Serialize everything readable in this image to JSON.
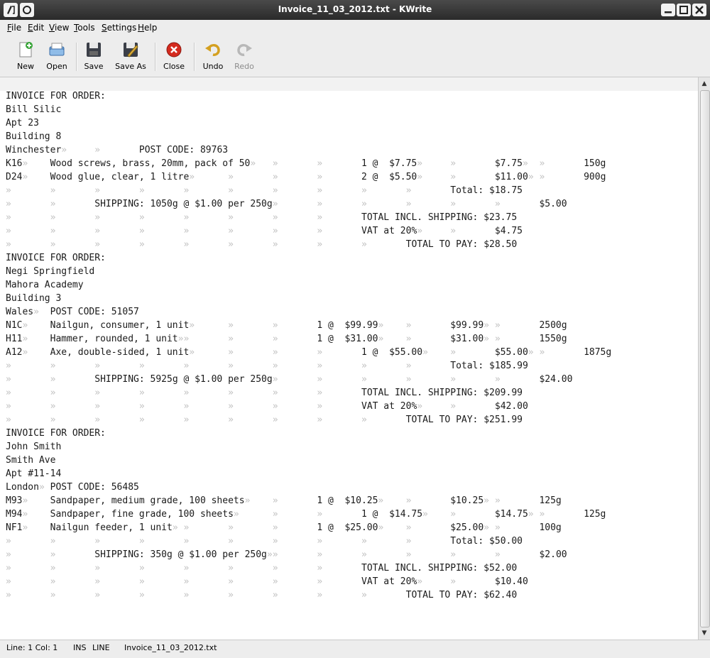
{
  "window": {
    "title": "Invoice_11_03_2012.txt - KWrite"
  },
  "menu": [
    "File",
    "Edit",
    "View",
    "Tools",
    "Settings",
    "Help"
  ],
  "toolbar": {
    "new": "New",
    "open": "Open",
    "save": "Save",
    "save_as": "Save As",
    "close": "Close",
    "undo": "Undo",
    "redo": "Redo"
  },
  "editor": {
    "tab_marker": "»",
    "lines": [
      [
        "INVOICE FOR ORDER:"
      ],
      [
        "Bill Silic"
      ],
      [
        "Apt 23"
      ],
      [
        "Building 8"
      ],
      [
        "Winchester",
        "",
        "POST CODE: 89763"
      ],
      [
        "K16",
        "Wood screws, brass, 20mm, pack of 50",
        "",
        "",
        "1 @  $7.75",
        "",
        "$7.75",
        "",
        "150g"
      ],
      [
        "D24",
        "Wood glue, clear, 1 litre",
        "",
        "",
        "",
        "2 @  $5.50",
        "",
        "$11.00",
        "",
        "900g"
      ],
      [
        "",
        "",
        "",
        "",
        "",
        "",
        "",
        "",
        "",
        "",
        "Total: $18.75"
      ],
      [
        "",
        "",
        "SHIPPING: 1050g @ $1.00 per 250g",
        "",
        "",
        "",
        "",
        "",
        "$5.00"
      ],
      [
        "",
        "",
        "",
        "",
        "",
        "",
        "",
        "",
        "TOTAL INCL. SHIPPING: $23.75"
      ],
      [
        "",
        "",
        "",
        "",
        "",
        "",
        "",
        "",
        "VAT at 20%",
        "",
        "$4.75"
      ],
      [
        "",
        "",
        "",
        "",
        "",
        "",
        "",
        "",
        "",
        "TOTAL TO PAY: $28.50"
      ],
      [
        "INVOICE FOR ORDER:"
      ],
      [
        "Negi Springfield"
      ],
      [
        "Mahora Academy"
      ],
      [
        "Building 3"
      ],
      [
        "Wales",
        "POST CODE: 51057"
      ],
      [
        "N1C",
        "Nailgun, consumer, 1 unit",
        "",
        "",
        "1 @  $99.99",
        "",
        "$99.99",
        "",
        "2500g"
      ],
      [
        "H11",
        "Hammer, rounded, 1 unit",
        "",
        "",
        "",
        "1 @  $31.00",
        "",
        "$31.00",
        "",
        "1550g"
      ],
      [
        "A12",
        "Axe, double-sided, 1 unit",
        "",
        "",
        "",
        "1 @  $55.00",
        "",
        "$55.00",
        "",
        "1875g"
      ],
      [
        "",
        "",
        "",
        "",
        "",
        "",
        "",
        "",
        "",
        "",
        "Total: $185.99"
      ],
      [
        "",
        "",
        "SHIPPING: 5925g @ $1.00 per 250g",
        "",
        "",
        "",
        "",
        "",
        "$24.00"
      ],
      [
        "",
        "",
        "",
        "",
        "",
        "",
        "",
        "",
        "TOTAL INCL. SHIPPING: $209.99"
      ],
      [
        "",
        "",
        "",
        "",
        "",
        "",
        "",
        "",
        "VAT at 20%",
        "",
        "$42.00"
      ],
      [
        "",
        "",
        "",
        "",
        "",
        "",
        "",
        "",
        "",
        "TOTAL TO PAY: $251.99"
      ],
      [
        "INVOICE FOR ORDER:"
      ],
      [
        "John Smith"
      ],
      [
        "Smith Ave"
      ],
      [
        "Apt #11-14"
      ],
      [
        "London",
        "POST CODE: 56485"
      ],
      [
        "M93",
        "Sandpaper, medium grade, 100 sheets",
        "",
        "1 @  $10.25",
        "",
        "$10.25",
        "",
        "125g"
      ],
      [
        "M94",
        "Sandpaper, fine grade, 100 sheets",
        "",
        "",
        "1 @  $14.75",
        "",
        "$14.75",
        "",
        "125g"
      ],
      [
        "NF1",
        "Nailgun feeder, 1 unit",
        "",
        "",
        "",
        "1 @  $25.00",
        "",
        "$25.00",
        "",
        "100g"
      ],
      [
        "",
        "",
        "",
        "",
        "",
        "",
        "",
        "",
        "",
        "",
        "Total: $50.00"
      ],
      [
        "",
        "",
        "SHIPPING: 350g @ $1.00 per 250g",
        "",
        "",
        "",
        "",
        "",
        "",
        "$2.00"
      ],
      [
        "",
        "",
        "",
        "",
        "",
        "",
        "",
        "",
        "TOTAL INCL. SHIPPING: $52.00"
      ],
      [
        "",
        "",
        "",
        "",
        "",
        "",
        "",
        "",
        "VAT at 20%",
        "",
        "$10.40"
      ],
      [
        "",
        "",
        "",
        "",
        "",
        "",
        "",
        "",
        "",
        "TOTAL TO PAY: $62.40"
      ]
    ]
  },
  "statusbar": {
    "position": "Line: 1 Col: 1",
    "mode": "INS",
    "selection": "LINE",
    "filename": "Invoice_11_03_2012.txt"
  },
  "colors": {
    "titlebar": "#2f2f2f",
    "chrome": "#ededed",
    "tab_marker": "#c0c0c0"
  },
  "icons": [
    "new-document-icon",
    "open-folder-icon",
    "save-disk-icon",
    "save-as-icon",
    "close-red-icon",
    "undo-arrow-icon",
    "redo-arrow-icon"
  ]
}
